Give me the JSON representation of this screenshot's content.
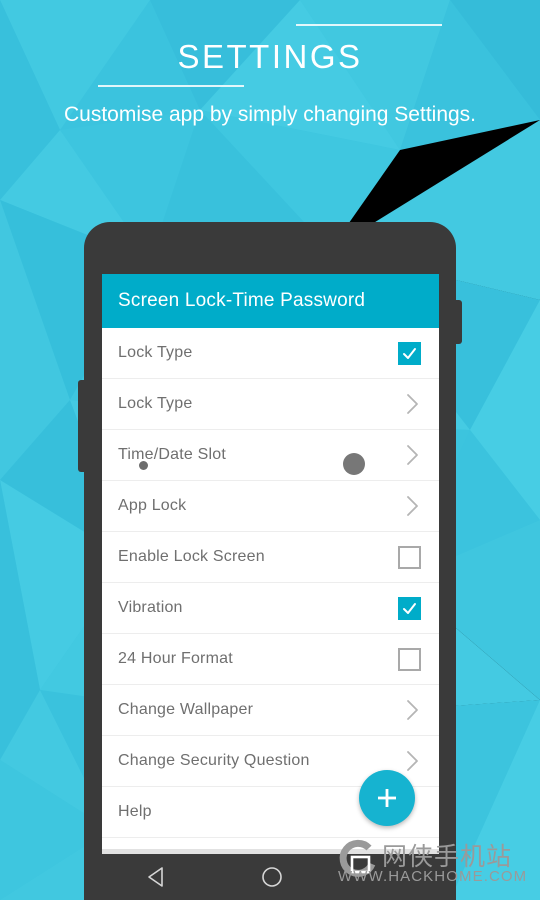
{
  "hero": {
    "title": "SETTINGS",
    "subtitle": "Customise app by simply changing Settings."
  },
  "colors": {
    "background": "#3bc3de",
    "accent": "#00acc9",
    "fab": "#16b3d0",
    "phone_body": "#3a3a3a",
    "row_text": "#6f6f6f",
    "checkbox_off_border": "#a9a9a9",
    "chevron": "#b5b5b5",
    "watermark": "#9a9a9a"
  },
  "phone": {
    "app_bar": {
      "title": "Screen Lock-Time Password"
    },
    "list": [
      {
        "label": "Lock Type",
        "control": "checkbox",
        "checked": true
      },
      {
        "label": "Lock Type",
        "control": "chevron",
        "checked": false
      },
      {
        "label": "Time/Date Slot",
        "control": "chevron",
        "checked": false
      },
      {
        "label": "App Lock",
        "control": "chevron",
        "checked": false
      },
      {
        "label": "Enable Lock Screen",
        "control": "checkbox",
        "checked": false
      },
      {
        "label": "Vibration",
        "control": "checkbox",
        "checked": true
      },
      {
        "label": "24 Hour Format",
        "control": "checkbox",
        "checked": false
      },
      {
        "label": "Change Wallpaper",
        "control": "chevron",
        "checked": false
      },
      {
        "label": "Change Security Question",
        "control": "chevron",
        "checked": false
      },
      {
        "label": "Help",
        "control": "none",
        "checked": false
      }
    ],
    "fab": {
      "icon": "plus-icon"
    },
    "navbar": {
      "back": "back-triangle-icon",
      "home": "home-circle-icon"
    }
  },
  "watermark": {
    "logo": "hackhome-logo-icon",
    "chinese": "网侠手机站",
    "url": "WWW.HACKHOME.COM"
  }
}
